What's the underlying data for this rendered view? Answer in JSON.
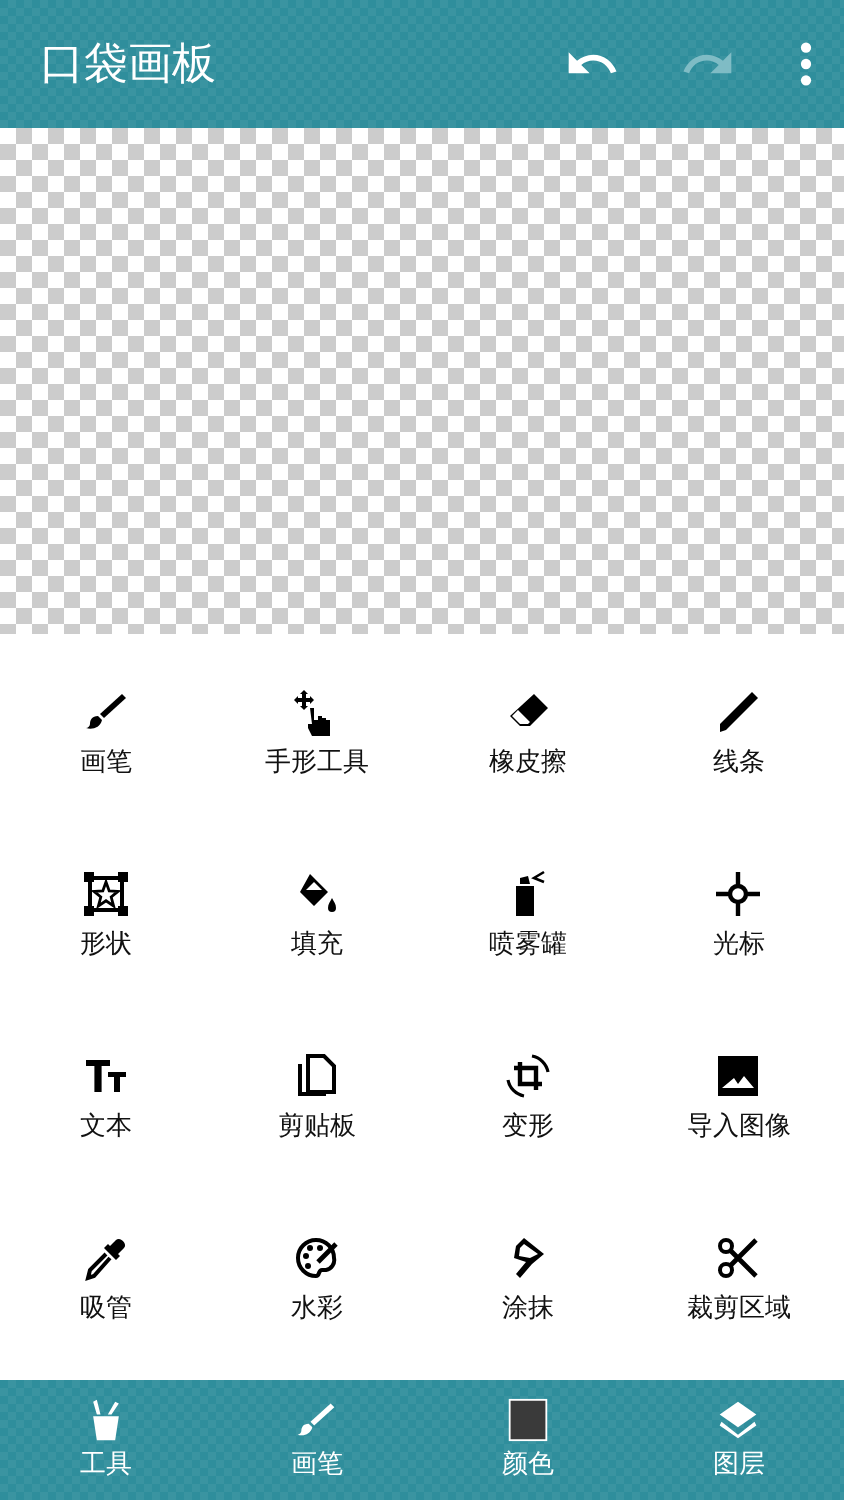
{
  "app_bar": {
    "title": "口袋画板",
    "actions": [
      {
        "kind": "undo",
        "disabled": false
      },
      {
        "kind": "redo",
        "disabled": true
      },
      {
        "kind": "more",
        "disabled": false
      }
    ]
  },
  "tools": [
    {
      "label": "画笔"
    },
    {
      "label": "手形工具"
    },
    {
      "label": "橡皮擦"
    },
    {
      "label": "线条"
    },
    {
      "label": "形状"
    },
    {
      "label": "填充"
    },
    {
      "label": "喷雾罐"
    },
    {
      "label": "光标"
    },
    {
      "label": "文本"
    },
    {
      "label": "剪贴板"
    },
    {
      "label": "变形"
    },
    {
      "label": "导入图像"
    },
    {
      "label": "吸管"
    },
    {
      "label": "水彩"
    },
    {
      "label": "涂抹"
    },
    {
      "label": "裁剪区域"
    }
  ],
  "bottom_nav": [
    {
      "kind": "tools",
      "label": "工具"
    },
    {
      "kind": "brush",
      "label": "画笔"
    },
    {
      "kind": "color",
      "label": "颜色"
    },
    {
      "kind": "layers",
      "label": "图层"
    }
  ]
}
